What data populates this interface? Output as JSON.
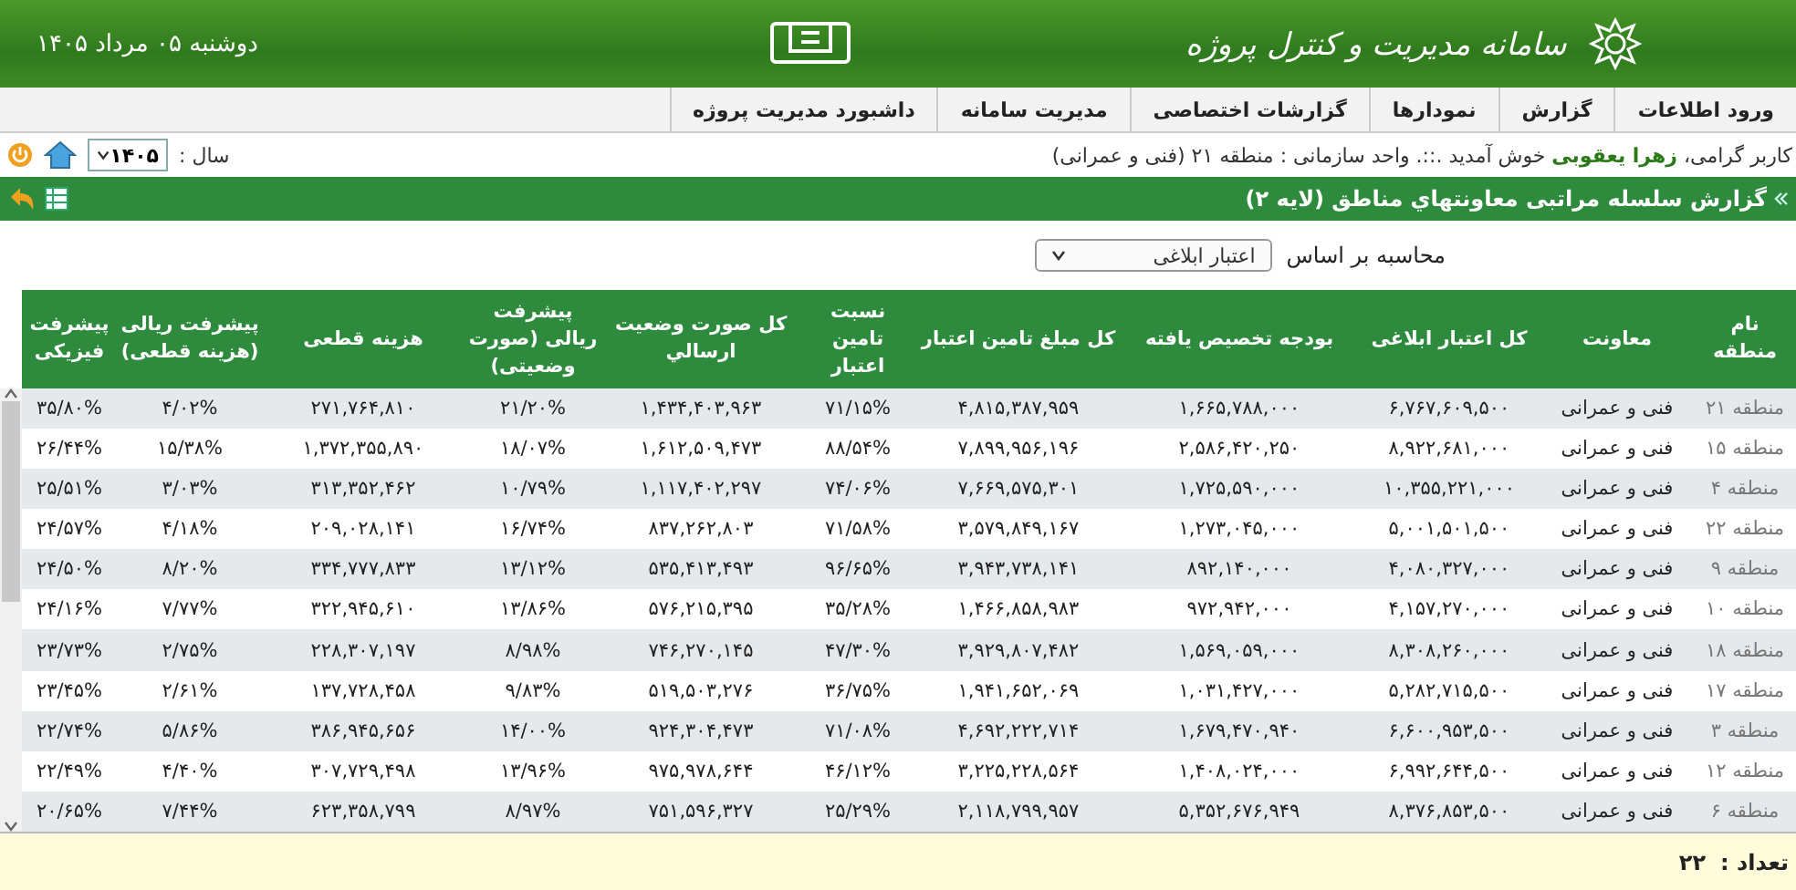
{
  "header": {
    "title": "سامانه مدیریت و کنترل پروژه",
    "date": "دوشنبه ۰۵ مرداد ۱۴۰۵"
  },
  "menu": [
    "ورود اطلاعات",
    "گزارش",
    "نمودارها",
    "گزارشات اختصاصی",
    "مدیریت سامانه",
    "داشبورد مدیریت پروژه"
  ],
  "user_bar": {
    "greeting": "کاربر گرامی، **زهرا یعقوبی** خوش آمدید .::. واحد سازمانی : منطقه ۲۱ (فنی و عمرانی)",
    "year_label": "سال :",
    "year_value": "۱۴۰۵"
  },
  "report_bar": {
    "title": "گزارش سلسله مراتبی معاونتهاي مناطق (لايه ۲)"
  },
  "filter": {
    "label": "محاسبه بر اساس",
    "value": "اعتبار ابلاغی"
  },
  "table": {
    "columns": [
      "نام منطقه",
      "معاونت",
      "کل اعتبار ابلاغی",
      "بودجه تخصیص یافته",
      "کل مبلغ تامین اعتبار",
      "نسبت تامین اعتبار",
      "کل صورت وضعیت ارسالي",
      "پیشرفت ریالی (صورت وضعیتی)",
      "هزینه قطعی",
      "پیشرفت ریالی (هزینه قطعی)",
      "پیشرفت فیزیکی"
    ],
    "rows": [
      [
        "منطقه ۲۱",
        "فنی و عمرانی",
        "۶,۷۶۷,۶۰۹,۵۰۰",
        "۱,۶۶۵,۷۸۸,۰۰۰",
        "۴,۸۱۵,۳۸۷,۹۵۹",
        "۷۱/۱۵%",
        "۱,۴۳۴,۴۰۳,۹۶۳",
        "۲۱/۲۰%",
        "۲۷۱,۷۶۴,۸۱۰",
        "۴/۰۲%",
        "۳۵/۸۰%"
      ],
      [
        "منطقه ۱۵",
        "فنی و عمرانی",
        "۸,۹۲۲,۶۸۱,۰۰۰",
        "۲,۵۸۶,۴۲۰,۲۵۰",
        "۷,۸۹۹,۹۵۶,۱۹۶",
        "۸۸/۵۴%",
        "۱,۶۱۲,۵۰۹,۴۷۳",
        "۱۸/۰۷%",
        "۱,۳۷۲,۳۵۵,۸۹۰",
        "۱۵/۳۸%",
        "۲۶/۴۴%"
      ],
      [
        "منطقه ۴",
        "فنی و عمرانی",
        "۱۰,۳۵۵,۲۲۱,۰۰۰",
        "۱,۷۲۵,۵۹۰,۰۰۰",
        "۷,۶۶۹,۵۷۵,۳۰۱",
        "۷۴/۰۶%",
        "۱,۱۱۷,۴۰۲,۲۹۷",
        "۱۰/۷۹%",
        "۳۱۳,۳۵۲,۴۶۲",
        "۳/۰۳%",
        "۲۵/۵۱%"
      ],
      [
        "منطقه ۲۲",
        "فنی و عمرانی",
        "۵,۰۰۱,۵۰۱,۵۰۰",
        "۱,۲۷۳,۰۴۵,۰۰۰",
        "۳,۵۷۹,۸۴۹,۱۶۷",
        "۷۱/۵۸%",
        "۸۳۷,۲۶۲,۸۰۳",
        "۱۶/۷۴%",
        "۲۰۹,۰۲۸,۱۴۱",
        "۴/۱۸%",
        "۲۴/۵۷%"
      ],
      [
        "منطقه ۹",
        "فنی و عمرانی",
        "۴,۰۸۰,۳۲۷,۰۰۰",
        "۸۹۲,۱۴۰,۰۰۰",
        "۳,۹۴۳,۷۳۸,۱۴۱",
        "۹۶/۶۵%",
        "۵۳۵,۴۱۳,۴۹۳",
        "۱۳/۱۲%",
        "۳۳۴,۷۷۷,۸۳۳",
        "۸/۲۰%",
        "۲۴/۵۰%"
      ],
      [
        "منطقه ۱۰",
        "فنی و عمرانی",
        "۴,۱۵۷,۲۷۰,۰۰۰",
        "۹۷۲,۹۴۲,۰۰۰",
        "۱,۴۶۶,۸۵۸,۹۸۳",
        "۳۵/۲۸%",
        "۵۷۶,۲۱۵,۳۹۵",
        "۱۳/۸۶%",
        "۳۲۲,۹۴۵,۶۱۰",
        "۷/۷۷%",
        "۲۴/۱۶%"
      ],
      [
        "منطقه ۱۸",
        "فنی و عمرانی",
        "۸,۳۰۸,۲۶۰,۰۰۰",
        "۱,۵۶۹,۰۵۹,۰۰۰",
        "۳,۹۲۹,۸۰۷,۴۸۲",
        "۴۷/۳۰%",
        "۷۴۶,۲۷۰,۱۴۵",
        "۸/۹۸%",
        "۲۲۸,۳۰۷,۱۹۷",
        "۲/۷۵%",
        "۲۳/۷۳%"
      ],
      [
        "منطقه ۱۷",
        "فنی و عمرانی",
        "۵,۲۸۲,۷۱۵,۵۰۰",
        "۱,۰۳۱,۴۲۷,۰۰۰",
        "۱,۹۴۱,۶۵۲,۰۶۹",
        "۳۶/۷۵%",
        "۵۱۹,۵۰۳,۲۷۶",
        "۹/۸۳%",
        "۱۳۷,۷۲۸,۴۵۸",
        "۲/۶۱%",
        "۲۳/۴۵%"
      ],
      [
        "منطقه ۳",
        "فنی و عمرانی",
        "۶,۶۰۰,۹۵۳,۵۰۰",
        "۱,۶۷۹,۴۷۰,۹۴۰",
        "۴,۶۹۲,۲۲۲,۷۱۴",
        "۷۱/۰۸%",
        "۹۲۴,۳۰۴,۴۷۳",
        "۱۴/۰۰%",
        "۳۸۶,۹۴۵,۶۵۶",
        "۵/۸۶%",
        "۲۲/۷۴%"
      ],
      [
        "منطقه ۱۲",
        "فنی و عمرانی",
        "۶,۹۹۲,۶۴۴,۵۰۰",
        "۱,۴۰۸,۰۲۴,۰۰۰",
        "۳,۲۲۵,۲۲۸,۵۶۴",
        "۴۶/۱۲%",
        "۹۷۵,۹۷۸,۶۴۴",
        "۱۳/۹۶%",
        "۳۰۷,۷۲۹,۴۹۸",
        "۴/۴۰%",
        "۲۲/۴۹%"
      ],
      [
        "منطقه ۶",
        "فنی و عمرانی",
        "۸,۳۷۶,۸۵۳,۵۰۰",
        "۵,۳۵۲,۶۷۶,۹۴۹",
        "۲,۱۱۸,۷۹۹,۹۵۷",
        "۲۵/۲۹%",
        "۷۵۱,۵۹۶,۳۲۷",
        "۸/۹۷%",
        "۶۲۳,۳۵۸,۷۹۹",
        "۷/۴۴%",
        "۲۰/۶۵%"
      ]
    ]
  },
  "footer": {
    "label": "تعداد :",
    "count": "۲۲"
  }
}
